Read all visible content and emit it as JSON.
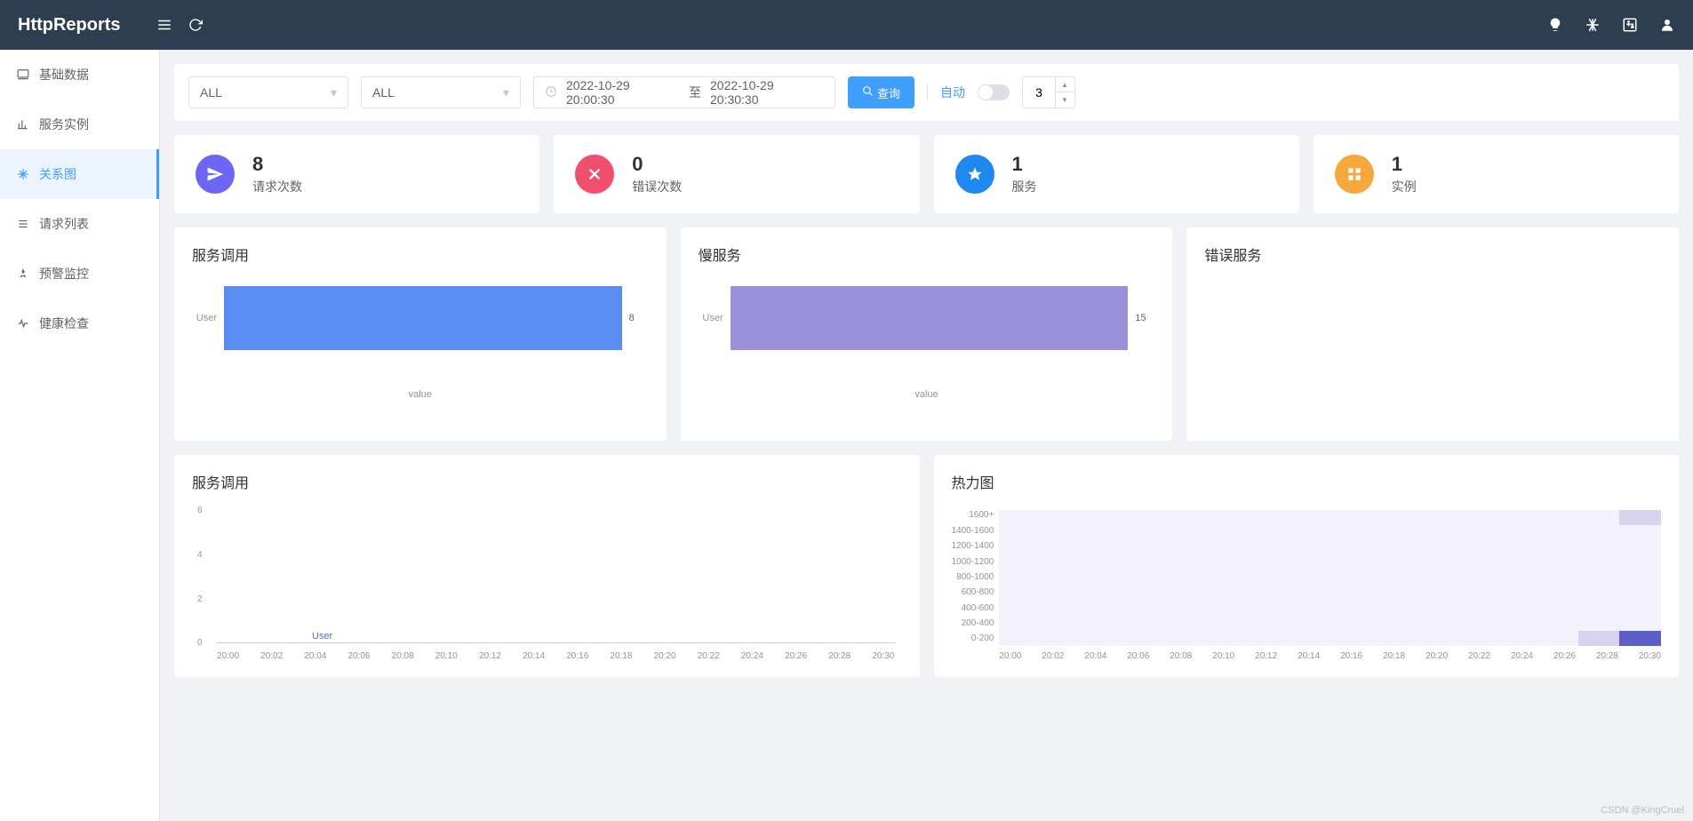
{
  "brand": "HttpReports",
  "sidebar": {
    "items": [
      {
        "label": "基础数据"
      },
      {
        "label": "服务实例"
      },
      {
        "label": "关系图"
      },
      {
        "label": "请求列表"
      },
      {
        "label": "预警监控"
      },
      {
        "label": "健康检查"
      }
    ]
  },
  "filters": {
    "select1": "ALL",
    "select2": "ALL",
    "dateStart": "2022-10-29 20:00:30",
    "dateSep": "至",
    "dateEnd": "2022-10-29 20:30:30",
    "queryBtn": "查询",
    "autoLabel": "自动",
    "interval": "3"
  },
  "stats": [
    {
      "value": "8",
      "label": "请求次数",
      "color": "#6c66f5"
    },
    {
      "value": "0",
      "label": "错误次数",
      "color": "#f0506e"
    },
    {
      "value": "1",
      "label": "服务",
      "color": "#1e87f0"
    },
    {
      "value": "1",
      "label": "实例",
      "color": "#f7a73b"
    }
  ],
  "panels": {
    "serviceCalls": "服务调用",
    "slowService": "慢服务",
    "errorService": "错误服务",
    "serviceCallsTrend": "服务调用",
    "heatmap": "热力图"
  },
  "chart_data": [
    {
      "id": "service_calls_bar",
      "type": "bar",
      "orientation": "horizontal",
      "categories": [
        "User"
      ],
      "values": [
        8
      ],
      "xlabel": "value",
      "color": "#5a8cf1",
      "xlim": [
        0,
        8
      ]
    },
    {
      "id": "slow_service_bar",
      "type": "bar",
      "orientation": "horizontal",
      "categories": [
        "User"
      ],
      "values": [
        15
      ],
      "xlabel": "value",
      "color": "#9a91da",
      "xlim": [
        0,
        15
      ]
    },
    {
      "id": "error_service",
      "type": "bar",
      "categories": [],
      "values": []
    },
    {
      "id": "service_calls_line",
      "type": "line",
      "x": [
        "20:00",
        "20:02",
        "20:04",
        "20:06",
        "20:08",
        "20:10",
        "20:12",
        "20:14",
        "20:16",
        "20:18",
        "20:20",
        "20:22",
        "20:24",
        "20:26",
        "20:28",
        "20:30"
      ],
      "series": [
        {
          "name": "User",
          "values": [
            0,
            0,
            0,
            0,
            0,
            0,
            0,
            0,
            0,
            0,
            0,
            0,
            0,
            0,
            0,
            0
          ]
        }
      ],
      "yticks": [
        0,
        2,
        4,
        6
      ],
      "ylim": [
        0,
        6
      ]
    },
    {
      "id": "heatmap",
      "type": "heatmap",
      "x": [
        "20:00",
        "20:02",
        "20:04",
        "20:06",
        "20:08",
        "20:10",
        "20:12",
        "20:14",
        "20:16",
        "20:18",
        "20:20",
        "20:22",
        "20:24",
        "20:26",
        "20:28",
        "20:30"
      ],
      "y": [
        "1600+",
        "1400-1600",
        "1200-1400",
        "1000-1200",
        "800-1000",
        "600-800",
        "400-600",
        "200-400",
        "0-200"
      ],
      "nonzero": [
        {
          "xi": 15,
          "yi": 0,
          "v": 1
        },
        {
          "xi": 14,
          "yi": 8,
          "v": 1
        },
        {
          "xi": 15,
          "yi": 8,
          "v": 2
        }
      ]
    }
  ],
  "watermark": "CSDN @KingCruel"
}
